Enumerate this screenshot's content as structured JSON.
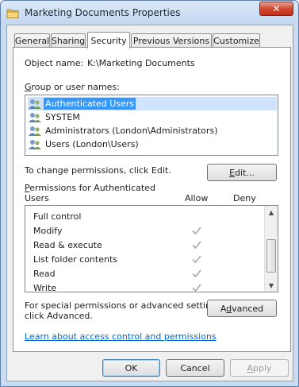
{
  "window": {
    "title": "Marketing Documents Properties",
    "close_glyph": "✕"
  },
  "tabs": [
    {
      "label": "General"
    },
    {
      "label": "Sharing"
    },
    {
      "label": "Security",
      "active": true
    },
    {
      "label": "Previous Versions"
    },
    {
      "label": "Customize"
    }
  ],
  "security": {
    "object_name_label": "Object name:",
    "object_name_value": "K:\\Marketing Documents",
    "group_label": "Group or user names:",
    "users": [
      {
        "name": "Authenticated Users",
        "selected": true,
        "icon": "users-group-icon"
      },
      {
        "name": "SYSTEM",
        "icon": "users-group-icon"
      },
      {
        "name": "Administrators (London\\Administrators)",
        "icon": "users-group-icon"
      },
      {
        "name": "Users (London\\Users)",
        "icon": "users-group-icon"
      }
    ],
    "change_text": "To change permissions, click Edit.",
    "edit_button": "Edit...",
    "permissions_label_line1": "Permissions for Authenticated",
    "permissions_label_line2": "Users",
    "allow_header": "Allow",
    "deny_header": "Deny",
    "permissions": [
      {
        "name": "Full control",
        "allow": false,
        "deny": false
      },
      {
        "name": "Modify",
        "allow": true,
        "deny": false
      },
      {
        "name": "Read & execute",
        "allow": true,
        "deny": false
      },
      {
        "name": "List folder contents",
        "allow": true,
        "deny": false
      },
      {
        "name": "Read",
        "allow": true,
        "deny": false
      },
      {
        "name": "Write",
        "allow": true,
        "deny": false
      }
    ],
    "special_text_line1": "For special permissions or advanced settings,",
    "special_text_line2": "click Advanced.",
    "advanced_button": "Advanced",
    "learn_link": "Learn about access control and permissions"
  },
  "footer": {
    "ok": "OK",
    "cancel": "Cancel",
    "apply": "Apply"
  },
  "colors": {
    "selection": "#3399ff",
    "link": "#0066cc",
    "check_grey": "#a8a8a8"
  }
}
